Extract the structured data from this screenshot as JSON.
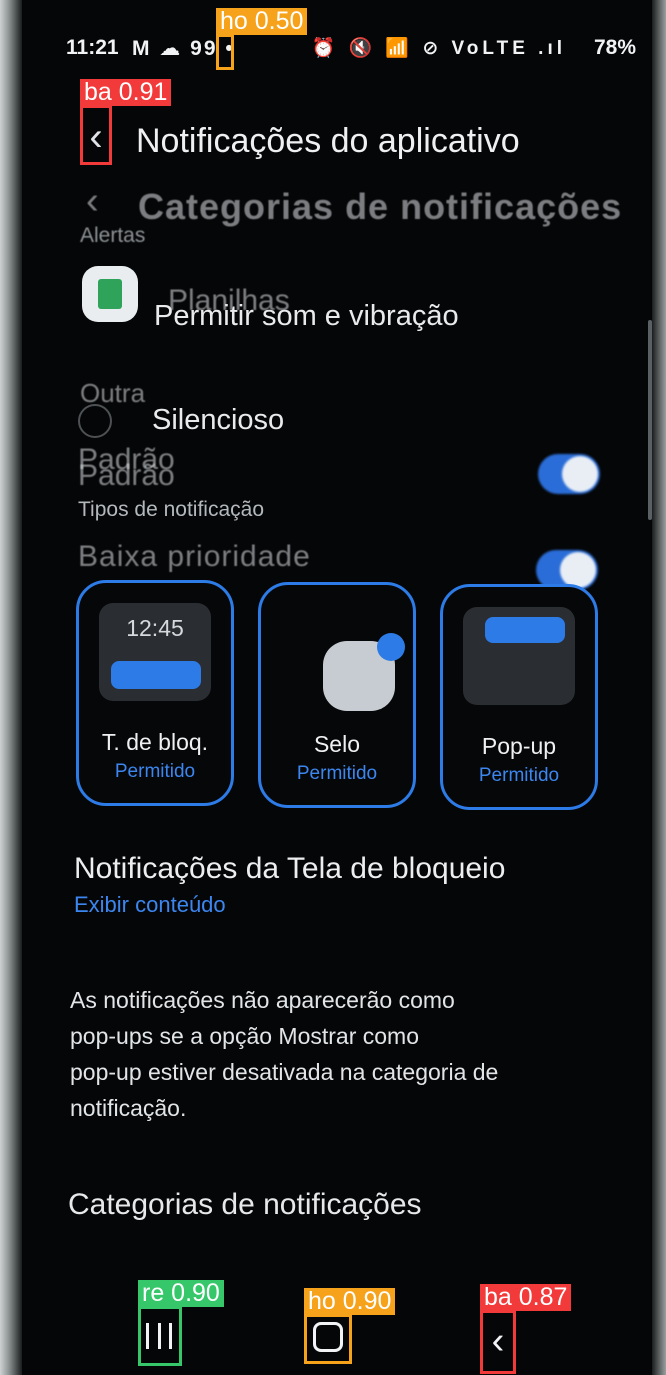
{
  "status_bar": {
    "time": "11:21",
    "left_icons": "M ☁ 99 •",
    "right_icons": "⏰ 🔇 📶 ⊘ VoLTE .ıl",
    "battery": "78%"
  },
  "header": {
    "title": "Notificações do aplicativo",
    "back_icon": "chevron-left"
  },
  "ghost_text": {
    "title": "Categorias de notificações",
    "alertas": "Alertas",
    "planilhas": "Planilhas",
    "outra": "Outra",
    "padrao": "Padrão",
    "baixa": "Baixa prioridade"
  },
  "options": {
    "sound": "Permitir som e vibração",
    "silent": "Silencioso"
  },
  "section": {
    "types_label": "Tipos de notificação"
  },
  "cards": [
    {
      "name": "T. de bloq.",
      "status": "Permitido",
      "preview_time": "12:45"
    },
    {
      "name": "Selo",
      "status": "Permitido"
    },
    {
      "name": "Pop-up",
      "status": "Permitido"
    }
  ],
  "lockscreen": {
    "title": "Notificações da Tela de bloqueio",
    "value": "Exibir conteúdo"
  },
  "description": [
    "As notificações não aparecerão como",
    "pop-ups se a opção Mostrar como",
    "pop-up estiver desativada na categoria de",
    "notificação."
  ],
  "categories_title": "Categorias de notificações",
  "detections": [
    {
      "label": "ho 0.50"
    },
    {
      "label": "ba 0.91"
    },
    {
      "label": "re 0.90"
    },
    {
      "label": "ho 0.90"
    },
    {
      "label": "ba 0.87"
    }
  ],
  "colors": {
    "accent": "#2d7be6",
    "link": "#3c86f0",
    "background": "#050607",
    "box_red": "#f23a3a",
    "box_orange": "#f7a21b",
    "box_green": "#35c76a"
  }
}
